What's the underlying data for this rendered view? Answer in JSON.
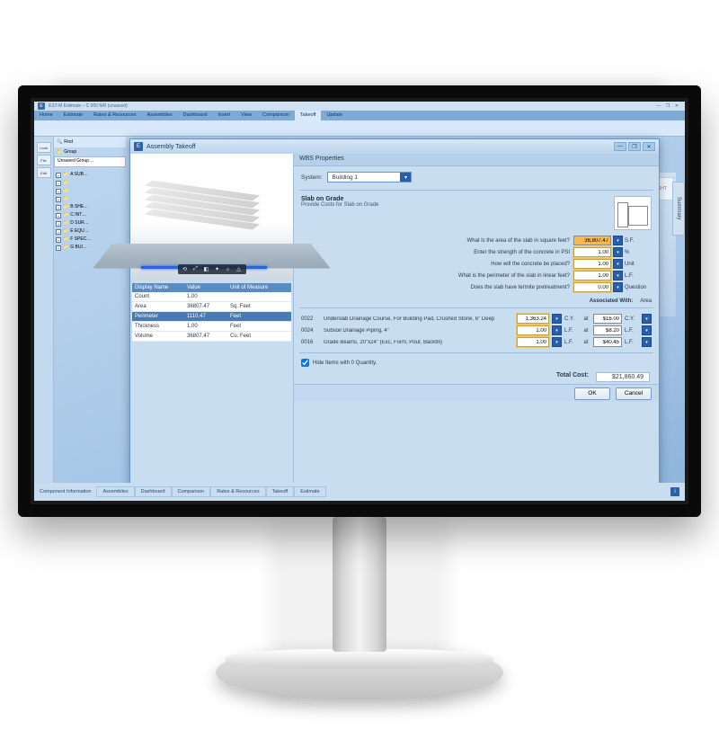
{
  "app": {
    "title": "EST-M Estimate – C 000 MR (unsaved)",
    "logo_glyph": "E"
  },
  "window_buttons": {
    "min": "—",
    "max": "❐",
    "close": "✕"
  },
  "ribbon": {
    "tabs": [
      "Home",
      "Estimate",
      "Rates & Resources",
      "Assemblies",
      "Dashboard",
      "Insert",
      "View",
      "Comparison",
      "Takeoff",
      "Update"
    ],
    "active_index": 8
  },
  "left_strip": [
    "Load",
    "File",
    "Edit"
  ],
  "find": {
    "label": "Find"
  },
  "group": {
    "label": "Group"
  },
  "unsaved_group_label": "Unsaved Group…",
  "tree": [
    "A SUB…",
    "",
    "",
    "",
    "B SHE…",
    "C INT…",
    "D SUR…",
    "E EQU…",
    "F SPEC…",
    "G BUI…"
  ],
  "summary_tab": "Summary",
  "cube_label": "RIGHT",
  "component_info_label": "Component Information",
  "bottom_tabs": [
    "Assemblies",
    "Dashboard",
    "Comparison",
    "Rates & Resources",
    "Takeoff",
    "Estimate"
  ],
  "modal": {
    "title": "Assembly Takeoff",
    "wbs_header": "WBS Properties",
    "system_label": "System:",
    "system_value": "Building 1",
    "section_title": "Slab on Grade",
    "section_sub": "Provide Costs for Slab on Grade",
    "assoc": {
      "label": "Associated With:",
      "value": "Area"
    },
    "questions": [
      {
        "q": "What is the area of the slab in square feet?",
        "value": "36,807.47",
        "unit": "S.F.",
        "hl": true
      },
      {
        "q": "Enter the strength of the concrete in PSI",
        "value": "1.00",
        "unit": "%"
      },
      {
        "q": "How will the concrete be placed?",
        "value": "1.00",
        "unit": "Unit"
      },
      {
        "q": "What is the perimeter of the slab in linear feet?",
        "value": "1.00",
        "unit": "L.F."
      },
      {
        "q": "Does the slab have termite pretreatment?",
        "value": "0.00",
        "unit": "Question"
      }
    ],
    "items": [
      {
        "code": "0022",
        "desc": "Underslab Drainage Course, For Building Pad, Crushed Stone, 6\" Deep",
        "qty": "1,363.24",
        "u1": "C.Y.",
        "rate": "$16.00",
        "u2": "C.Y."
      },
      {
        "code": "0024",
        "desc": "Subsoil Drainage Piping, 4\"",
        "qty": "1.00",
        "u1": "L.F.",
        "rate": "$8.20",
        "u2": "L.F."
      },
      {
        "code": "0016",
        "desc": "Grade Beams, 20\"x24\" (Exc, Form, Pour, Backfill)",
        "qty": "1.00",
        "u1": "L.F.",
        "rate": "$40.45",
        "u2": "L.F."
      }
    ],
    "hide_label": "Hide Items with 0 Quantity.",
    "total_label": "Total Cost:",
    "total_value": "$21,860.49",
    "buttons": {
      "ok": "OK",
      "cancel": "Cancel"
    },
    "dims": {
      "headers": [
        "Display Name",
        "Value",
        "Unit of Measure"
      ],
      "rows": [
        {
          "name": "Count",
          "value": "1.00",
          "uom": ""
        },
        {
          "name": "Area",
          "value": "36807.47",
          "uom": "Sq. Feet"
        },
        {
          "name": "Perimeter",
          "value": "1110.47",
          "uom": "Feet",
          "sel": true
        },
        {
          "name": "Thickness",
          "value": "1.00",
          "uom": "Feet"
        },
        {
          "name": "Volume",
          "value": "36807.47",
          "uom": "Cu. Feet"
        }
      ]
    },
    "view_controls": [
      "⟲",
      "⤢",
      "◧",
      "✦",
      "⌂",
      "△"
    ]
  },
  "glyphs": {
    "dd": "▾",
    "mag": "🔍",
    "folder": "📁",
    "check": "✓",
    "info": "i"
  }
}
